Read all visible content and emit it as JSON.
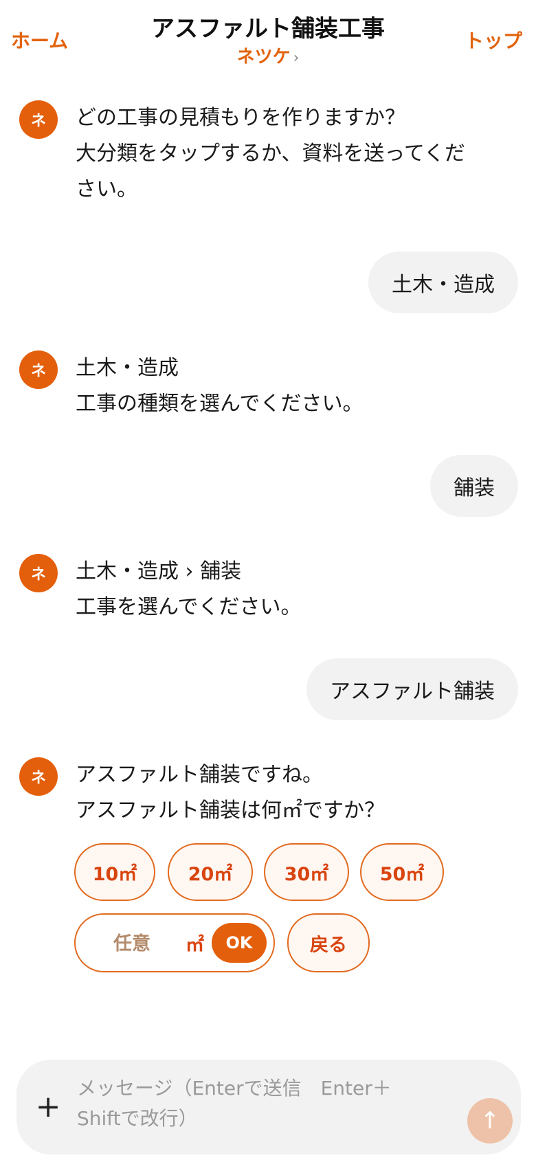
{
  "header": {
    "home_label": "ホーム",
    "title": "アスファルト舗装工事",
    "subtitle": "ネツケ",
    "subtitle_chevron": "›",
    "top_label": "トップ"
  },
  "avatar_label": "ネ",
  "messages": [
    {
      "role": "bot",
      "lines": [
        "どの工事の見積もりを作りますか？",
        "大分類をタップするか、資料を送ってくだ",
        "さい。"
      ]
    },
    {
      "role": "user",
      "text": "土木・造成"
    },
    {
      "role": "bot",
      "lines": [
        "土木・造成",
        "工事の種類を選んでください。"
      ]
    },
    {
      "role": "user",
      "text": "舗装"
    },
    {
      "role": "bot",
      "lines": [
        "土木・造成 › 舗装",
        "工事を選んでください。"
      ]
    },
    {
      "role": "user",
      "text": "アスファルト舗装"
    },
    {
      "role": "bot",
      "lines": [
        "アスファルト舗装ですね。",
        "アスファルト舗装は何㎡ですか？"
      ]
    }
  ],
  "options": [
    "10㎡",
    "20㎡",
    "30㎡",
    "50㎡"
  ],
  "custom_input": {
    "placeholder": "任意",
    "unit": "㎡",
    "ok_label": "OK"
  },
  "back_label": "戻る",
  "composer": {
    "plus_symbol": "+",
    "placeholder": "メッセージ（Enterで送信　Enter＋Shiftで改行）",
    "send_symbol": "↑"
  },
  "colors": {
    "accent": "#e45f0b",
    "chip_text": "#d9440f",
    "send_disabled": "#eec2a8"
  }
}
